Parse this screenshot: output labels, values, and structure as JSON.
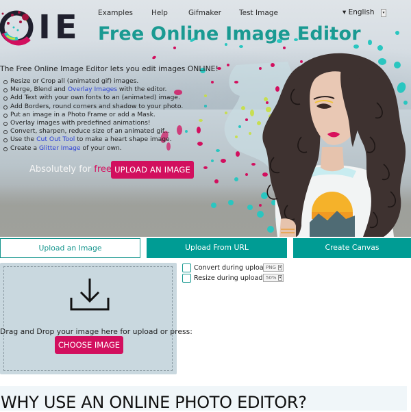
{
  "brand": {
    "logo_text": "IE",
    "colors": {
      "teal": "#009c94",
      "title_teal": "#1a9a92",
      "magenta": "#d20f5e",
      "link_blue": "#2b3fd6",
      "dropzone_bg": "#c9d8df"
    }
  },
  "nav": {
    "items": [
      {
        "label": "Examples"
      },
      {
        "label": "Help"
      },
      {
        "label": "Gifmaker"
      },
      {
        "label": "Test Image"
      }
    ],
    "language": {
      "label": "▾ English",
      "button_icon": "▾"
    }
  },
  "hero": {
    "title": "Free Online Image Editor",
    "intro": "The Free Online Image Editor lets you edit images ONLINE!",
    "features": [
      {
        "before": "Resize or Crop all (animated gif) images.",
        "link": "",
        "after": ""
      },
      {
        "before": "Merge, Blend and ",
        "link": "Overlay Images",
        "after": " with the editor."
      },
      {
        "before": "Add Text with your own fonts to an (animated) image.",
        "link": "",
        "after": ""
      },
      {
        "before": "Add Borders, round corners and shadow to your photo.",
        "link": "",
        "after": ""
      },
      {
        "before": "Put an image in a Photo Frame or add a Mask.",
        "link": "",
        "after": ""
      },
      {
        "before": "Overlay images with predefined animations!",
        "link": "",
        "after": ""
      },
      {
        "before": "Convert, sharpen, reduce size of an animated gif...",
        "link": "",
        "after": ""
      },
      {
        "before": "Use the ",
        "link": "Cut Out Tool",
        "after": " to make a heart shape image."
      },
      {
        "before": "Create a ",
        "link": "Glitter Image",
        "after": " of your own."
      }
    ],
    "free_prefix": "Absolutely for ",
    "free_word": "free",
    "upload_button": "UPLOAD AN IMAGE"
  },
  "tabs": [
    {
      "label": "Upload an Image",
      "active": true
    },
    {
      "label": "Upload From URL",
      "active": false
    },
    {
      "label": "Create Canvas",
      "active": false
    }
  ],
  "upload": {
    "drop_text": "Drag and Drop your image here for upload or press:",
    "choose_button": "CHOOSE IMAGE",
    "options": [
      {
        "label": "Convert during upload",
        "checked": false,
        "select_value": "PNG"
      },
      {
        "label": "Resize during upload",
        "checked": false,
        "select_value": "50%"
      }
    ]
  },
  "why": {
    "heading": "WHY USE AN ONLINE PHOTO EDITOR?"
  }
}
